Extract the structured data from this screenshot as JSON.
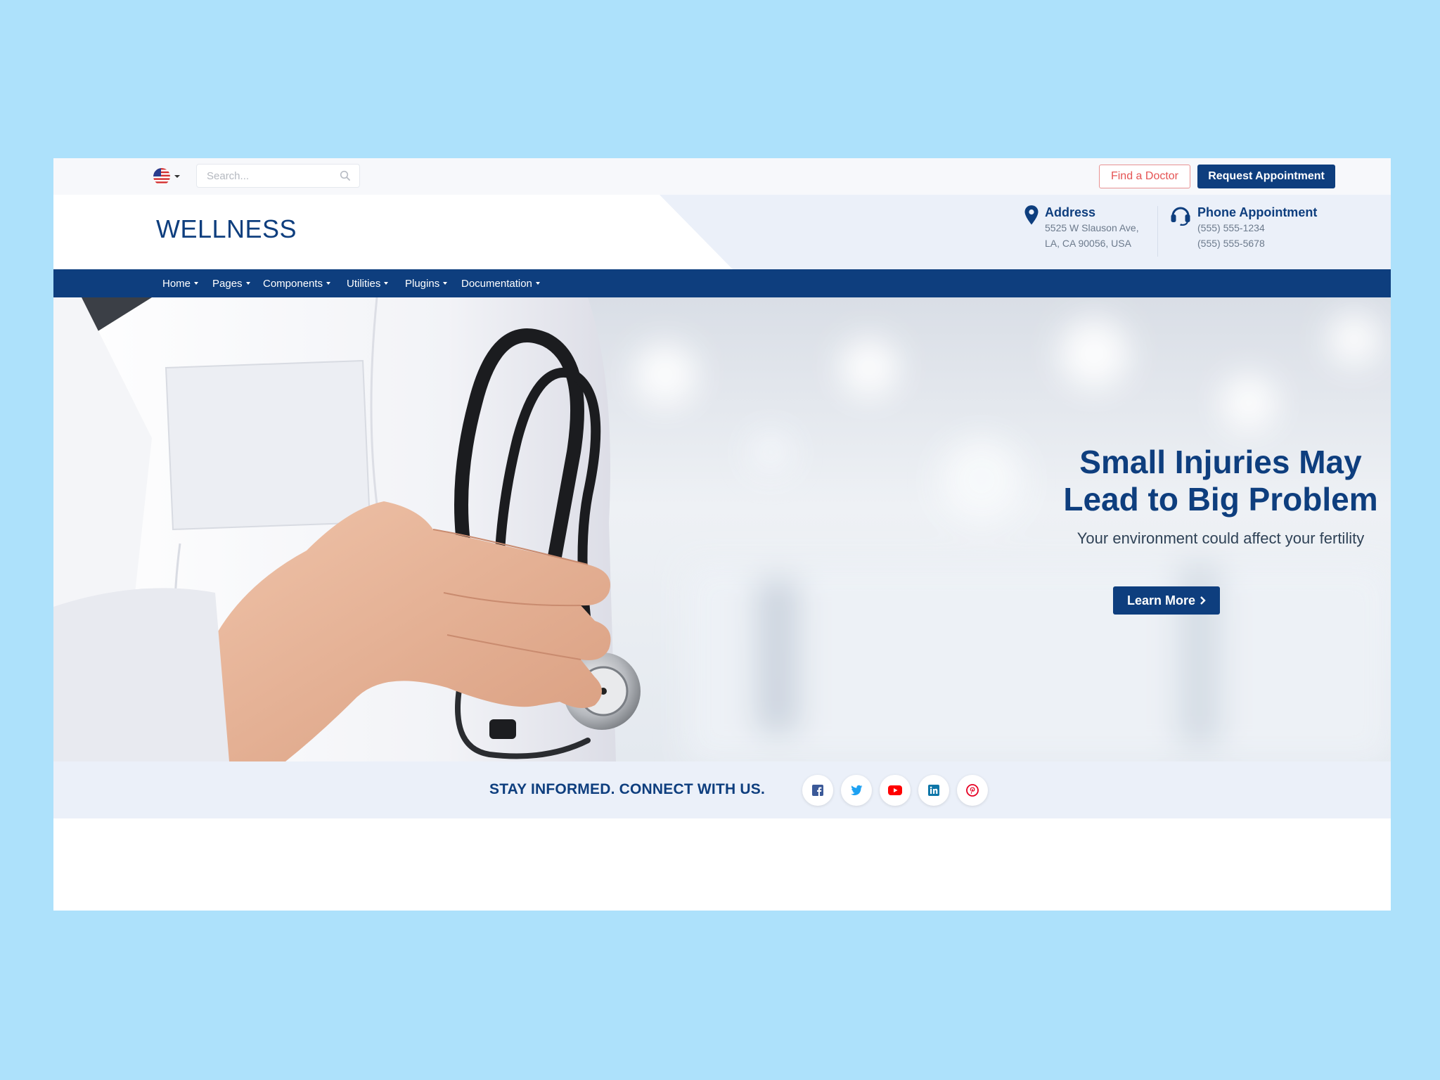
{
  "topbar": {
    "language": "English (US)",
    "search_placeholder": "Search...",
    "find_doctor": "Find a Doctor",
    "request_appointment": "Request Appointment"
  },
  "header": {
    "brand": "WELLNESS",
    "address": {
      "title": "Address",
      "line1": "5525 W Slauson Ave,",
      "line2": "LA, CA 90056, USA"
    },
    "phone": {
      "title": "Phone Appointment",
      "line1": "(555) 555-1234",
      "line2": "(555) 555-5678"
    }
  },
  "nav": {
    "items": [
      {
        "label": "Home"
      },
      {
        "label": "Pages"
      },
      {
        "label": "Components"
      },
      {
        "label": "Utilities"
      },
      {
        "label": "Plugins"
      },
      {
        "label": "Documentation"
      }
    ]
  },
  "hero": {
    "title_line1": "Small Injuries May",
    "title_line2": "Lead to Big Problem",
    "subtitle": "Your environment could affect your fertility",
    "cta": "Learn More"
  },
  "connect": {
    "text": "STAY INFORMED. CONNECT WITH US.",
    "socials": [
      {
        "name": "facebook",
        "color": "#3b5998"
      },
      {
        "name": "twitter",
        "color": "#1da1f2"
      },
      {
        "name": "youtube",
        "color": "#ff0000"
      },
      {
        "name": "linkedin",
        "color": "#0e76a8"
      },
      {
        "name": "pinterest",
        "color": "#e60023"
      }
    ]
  },
  "colors": {
    "primary": "#0e3e7e",
    "accent_red": "#e55353",
    "page_background": "#ade1fb",
    "band_background": "#ebf0f9"
  }
}
